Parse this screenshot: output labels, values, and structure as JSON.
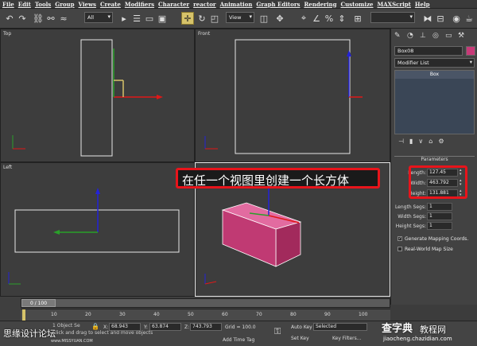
{
  "menu": [
    "File",
    "Edit",
    "Tools",
    "Group",
    "Views",
    "Create",
    "Modifiers",
    "Character",
    "reactor",
    "Animation",
    "Graph Editors",
    "Rendering",
    "Customize",
    "MAXScript",
    "Help"
  ],
  "toolbar": {
    "selection_filter": "All",
    "coord_system": "View"
  },
  "viewports": {
    "top": "Top",
    "front": "Front",
    "left": "Left"
  },
  "annotation": "在任一个视图里创建一个长方体",
  "panel": {
    "object_name": "Box08",
    "modifier_list": "Modifier List",
    "stack_item": "Box",
    "rollout_title": "Parameters",
    "params": [
      {
        "label": "Length:",
        "value": "127.45"
      },
      {
        "label": "Width:",
        "value": "463.792"
      },
      {
        "label": "Height:",
        "value": "131.881"
      },
      {
        "label": "Length Segs:",
        "value": "1"
      },
      {
        "label": "Width Segs:",
        "value": "1"
      },
      {
        "label": "Height Segs:",
        "value": "1"
      }
    ],
    "gen_mapping": "Generate Mapping Coords.",
    "real_world": "Real-World Map Size",
    "gen_mapping_checked": true,
    "real_world_checked": false
  },
  "timeline": {
    "frame": "0 / 100",
    "ticks": [
      "10",
      "20",
      "30",
      "40",
      "50",
      "60",
      "70",
      "80",
      "90",
      "100"
    ]
  },
  "status": {
    "selected_text": "1 Object Se",
    "prompt": "Click and drag to select and move objects",
    "x": "68.943",
    "y": "63.874",
    "z": "743.793",
    "grid": "Grid = 100.0",
    "auto_key": "Auto Key",
    "set_key": "Set Key",
    "key_mode": "Selected",
    "key_filters": "Key Filters...",
    "add_time_tag": "Add Time Tag",
    "x_label": "X:",
    "y_label": "Y:",
    "z_label": "Z:"
  },
  "watermark_left": "思缘设计论坛",
  "watermark_right_logo": "查字典",
  "watermark_right_sub": "教程网",
  "watermark_url_left": "www.MISSYUAN.COM",
  "watermark_url_right": "jiaocheng.chazidian.com",
  "colors": {
    "accent_red": "#e8141b",
    "box_pink": "#c83a78",
    "gizmo_yellow": "#d6c36a"
  }
}
